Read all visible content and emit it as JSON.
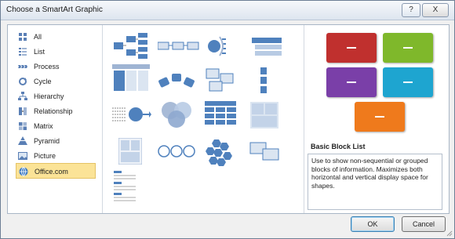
{
  "dialog": {
    "title": "Choose a SmartArt Graphic",
    "help_label": "?",
    "close_label": "X"
  },
  "categories": [
    {
      "label": "All",
      "icon": "all-icon"
    },
    {
      "label": "List",
      "icon": "list-icon"
    },
    {
      "label": "Process",
      "icon": "process-icon"
    },
    {
      "label": "Cycle",
      "icon": "cycle-icon"
    },
    {
      "label": "Hierarchy",
      "icon": "hierarchy-icon"
    },
    {
      "label": "Relationship",
      "icon": "relationship-icon"
    },
    {
      "label": "Matrix",
      "icon": "matrix-icon"
    },
    {
      "label": "Pyramid",
      "icon": "pyramid-icon"
    },
    {
      "label": "Picture",
      "icon": "picture-icon"
    },
    {
      "label": "Office.com",
      "icon": "office-com-icon",
      "selected": true
    }
  ],
  "preview": {
    "layout_name": "Basic Block List",
    "description": "Use to show non-sequential or grouped blocks of information. Maximizes both horizontal and vertical display space for shapes.",
    "block_colors": [
      "#c0302e",
      "#7fb82b",
      "#7a3fa8",
      "#1ea5d0",
      "#ef7a1c"
    ]
  },
  "buttons": {
    "ok": "OK",
    "cancel": "Cancel"
  },
  "colors": {
    "accent": "#4f81bd",
    "selection": "#fbe397"
  }
}
